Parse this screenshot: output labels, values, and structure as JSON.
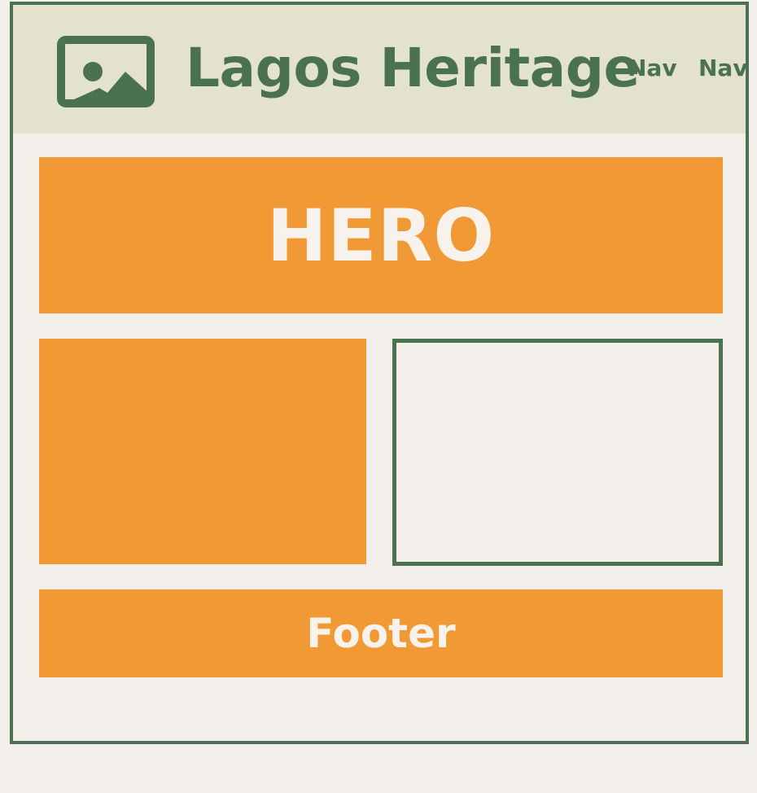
{
  "header": {
    "logo_icon": "image-placeholder-icon",
    "title": "Lagos Heritage",
    "nav": [
      "Nav",
      "Nav"
    ]
  },
  "hero": {
    "label": "HERO"
  },
  "footer": {
    "label": "Footer"
  },
  "colors": {
    "primary_green": "#4a7251",
    "accent_orange": "#f19934",
    "header_bg": "#e3e2cf",
    "page_bg": "#f2efea"
  }
}
